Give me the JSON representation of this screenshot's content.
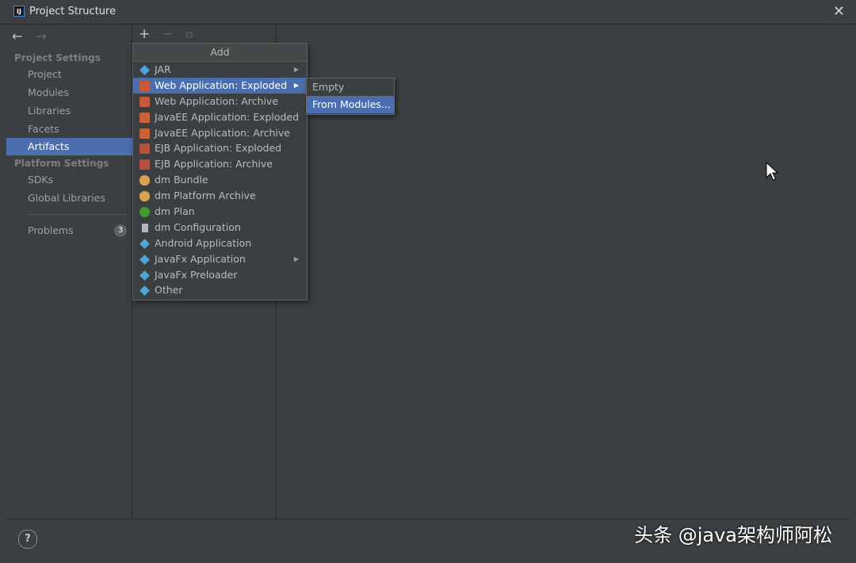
{
  "window": {
    "title": "Project Structure",
    "app_icon": "IJ"
  },
  "nav": {
    "back": "←",
    "forward": "→",
    "project_settings": "Project Settings",
    "items": [
      "Project",
      "Modules",
      "Libraries",
      "Facets",
      "Artifacts"
    ],
    "selected": "Artifacts",
    "platform_settings": "Platform Settings",
    "platform_items": [
      "SDKs",
      "Global Libraries"
    ],
    "problems": "Problems",
    "problems_count": "3"
  },
  "toolbar": {
    "add": "+",
    "remove": "−",
    "copy": "⧉"
  },
  "add_menu": {
    "title": "Add",
    "items": [
      {
        "label": "JAR",
        "icon": "diamond-icon",
        "submenu": true
      },
      {
        "label": "Web Application: Exploded",
        "icon": "web-icon",
        "submenu": true,
        "highlighted": true
      },
      {
        "label": "Web Application: Archive",
        "icon": "web-icon"
      },
      {
        "label": "JavaEE Application: Exploded",
        "icon": "javaee-icon"
      },
      {
        "label": "JavaEE Application: Archive",
        "icon": "javaee-icon"
      },
      {
        "label": "EJB Application: Exploded",
        "icon": "ejb-icon"
      },
      {
        "label": "EJB Application: Archive",
        "icon": "ejb-icon"
      },
      {
        "label": "dm Bundle",
        "icon": "bundle-icon"
      },
      {
        "label": "dm Platform Archive",
        "icon": "bundle-icon"
      },
      {
        "label": "dm Plan",
        "icon": "plan-icon"
      },
      {
        "label": "dm Configuration",
        "icon": "config-icon"
      },
      {
        "label": "Android Application",
        "icon": "diamond-icon"
      },
      {
        "label": "JavaFx Application",
        "icon": "diamond-icon",
        "submenu": true
      },
      {
        "label": "JavaFx Preloader",
        "icon": "diamond-icon"
      },
      {
        "label": "Other",
        "icon": "diamond-icon"
      }
    ]
  },
  "submenu": {
    "items": [
      "Empty",
      "From Modules..."
    ],
    "highlighted": "From Modules..."
  },
  "bottom": {
    "help": "?",
    "watermark": "头条 @java架构师阿松"
  },
  "colors": {
    "selection": "#4b6eaf",
    "background": "#3c3f41"
  }
}
